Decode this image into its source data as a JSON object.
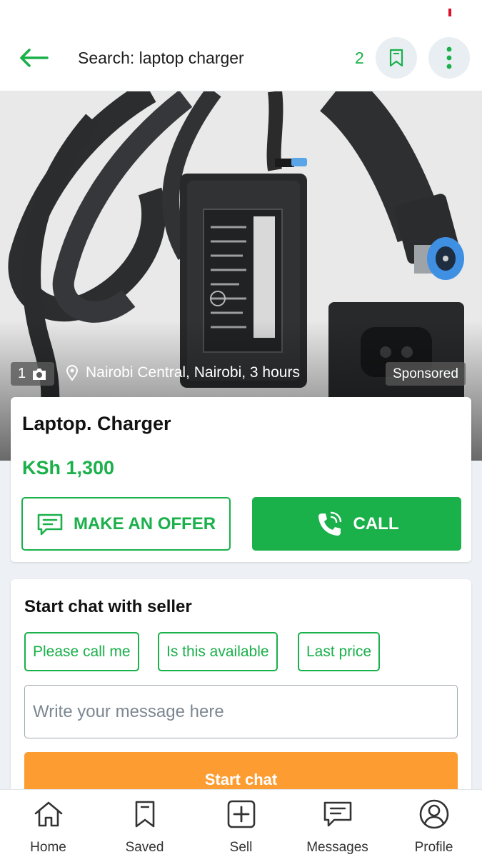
{
  "header": {
    "title": "Search: laptop charger",
    "saved_count": "2",
    "back_icon": "back-arrow-icon",
    "bookmark_icon": "bookmark-icon",
    "more_icon": "more-vertical-icon"
  },
  "listing": {
    "photo_count": "1",
    "location": "Nairobi Central, Nairobi, 3 hours",
    "sponsored_label": "Sponsored",
    "title": "Laptop. Charger",
    "price": "KSh 1,300",
    "offer_label": "MAKE AN OFFER",
    "call_label": "CALL"
  },
  "chat": {
    "title": "Start chat with seller",
    "quick_replies": [
      "Please call me",
      "Is this available",
      "Last price"
    ],
    "message_placeholder": "Write your message here",
    "start_label": "Start chat"
  },
  "nav": {
    "items": [
      {
        "label": "Home",
        "icon": "home-icon"
      },
      {
        "label": "Saved",
        "icon": "bookmark-icon"
      },
      {
        "label": "Sell",
        "icon": "plus-square-icon"
      },
      {
        "label": "Messages",
        "icon": "chat-icon"
      },
      {
        "label": "Profile",
        "icon": "user-circle-icon"
      }
    ]
  },
  "colors": {
    "accent": "#1ab04a",
    "start_chat": "#fd9c31",
    "background": "#edf1f5"
  }
}
